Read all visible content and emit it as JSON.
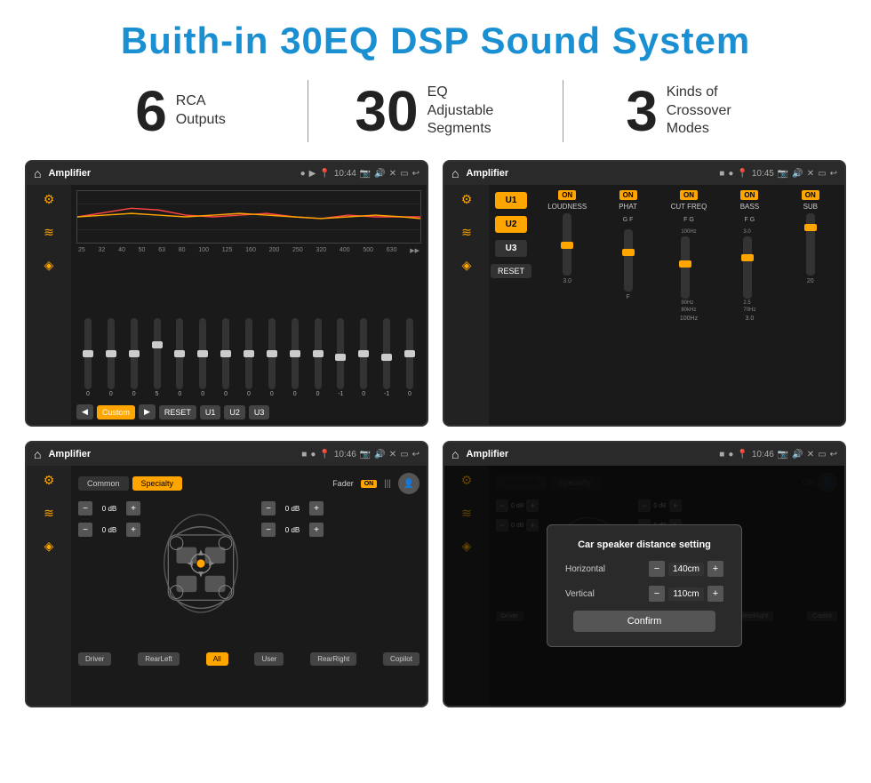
{
  "page": {
    "title": "Buith-in 30EQ DSP Sound System"
  },
  "stats": [
    {
      "number": "6",
      "label": "RCA\nOutputs"
    },
    {
      "number": "30",
      "label": "EQ Adjustable\nSegments"
    },
    {
      "number": "3",
      "label": "Kinds of\nCrossover Modes"
    }
  ],
  "screens": [
    {
      "id": "screen1",
      "topbar": {
        "title": "Amplifier",
        "time": "10:44"
      },
      "type": "eq"
    },
    {
      "id": "screen2",
      "topbar": {
        "title": "Amplifier",
        "time": "10:45"
      },
      "type": "amp"
    },
    {
      "id": "screen3",
      "topbar": {
        "title": "Amplifier",
        "time": "10:46"
      },
      "type": "fader"
    },
    {
      "id": "screen4",
      "topbar": {
        "title": "Amplifier",
        "time": "10:46"
      },
      "type": "distance",
      "dialog": {
        "title": "Car speaker distance setting",
        "horizontal_label": "Horizontal",
        "horizontal_value": "140cm",
        "vertical_label": "Vertical",
        "vertical_value": "110cm",
        "confirm_label": "Confirm"
      }
    }
  ],
  "eq": {
    "frequencies": [
      "25",
      "32",
      "40",
      "50",
      "63",
      "80",
      "100",
      "125",
      "160",
      "200",
      "250",
      "320",
      "400",
      "500",
      "630"
    ],
    "values": [
      "0",
      "0",
      "0",
      "5",
      "0",
      "0",
      "0",
      "0",
      "0",
      "0",
      "0",
      "-1",
      "0",
      "-1",
      "0"
    ],
    "presets": [
      "Custom",
      "RESET",
      "U1",
      "U2",
      "U3"
    ]
  },
  "amp": {
    "channels": [
      {
        "label": "LOUDNESS",
        "on": true,
        "value": "3.0"
      },
      {
        "label": "PHAT",
        "on": true,
        "value": "F"
      },
      {
        "label": "CUT FREQ",
        "on": true,
        "value": "100Hz"
      },
      {
        "label": "BASS",
        "on": true,
        "value": "3.0"
      },
      {
        "label": "SUB",
        "on": true,
        "value": "20"
      }
    ],
    "presets": [
      "U1",
      "U2",
      "U3"
    ],
    "reset": "RESET"
  },
  "fader": {
    "tabs": [
      "Common",
      "Specialty"
    ],
    "active_tab": "Specialty",
    "fader_label": "Fader",
    "on_label": "ON",
    "db_values": [
      "0 dB",
      "0 dB",
      "0 dB",
      "0 dB"
    ],
    "buttons": [
      "Driver",
      "RearLeft",
      "All",
      "User",
      "RearRight",
      "Copilot"
    ]
  },
  "distance": {
    "tabs": [
      "Common",
      "Specialty"
    ],
    "active_tab": "Common",
    "dialog_title": "Car speaker distance setting",
    "horizontal_label": "Horizontal",
    "horizontal_value": "140cm",
    "vertical_label": "Vertical",
    "vertical_value": "110cm",
    "confirm_label": "Confirm",
    "db_values": [
      "0 dB",
      "0 dB"
    ],
    "buttons": [
      "Driver",
      "RearLeft",
      "All",
      "User",
      "RearRight",
      "Copilot"
    ]
  }
}
